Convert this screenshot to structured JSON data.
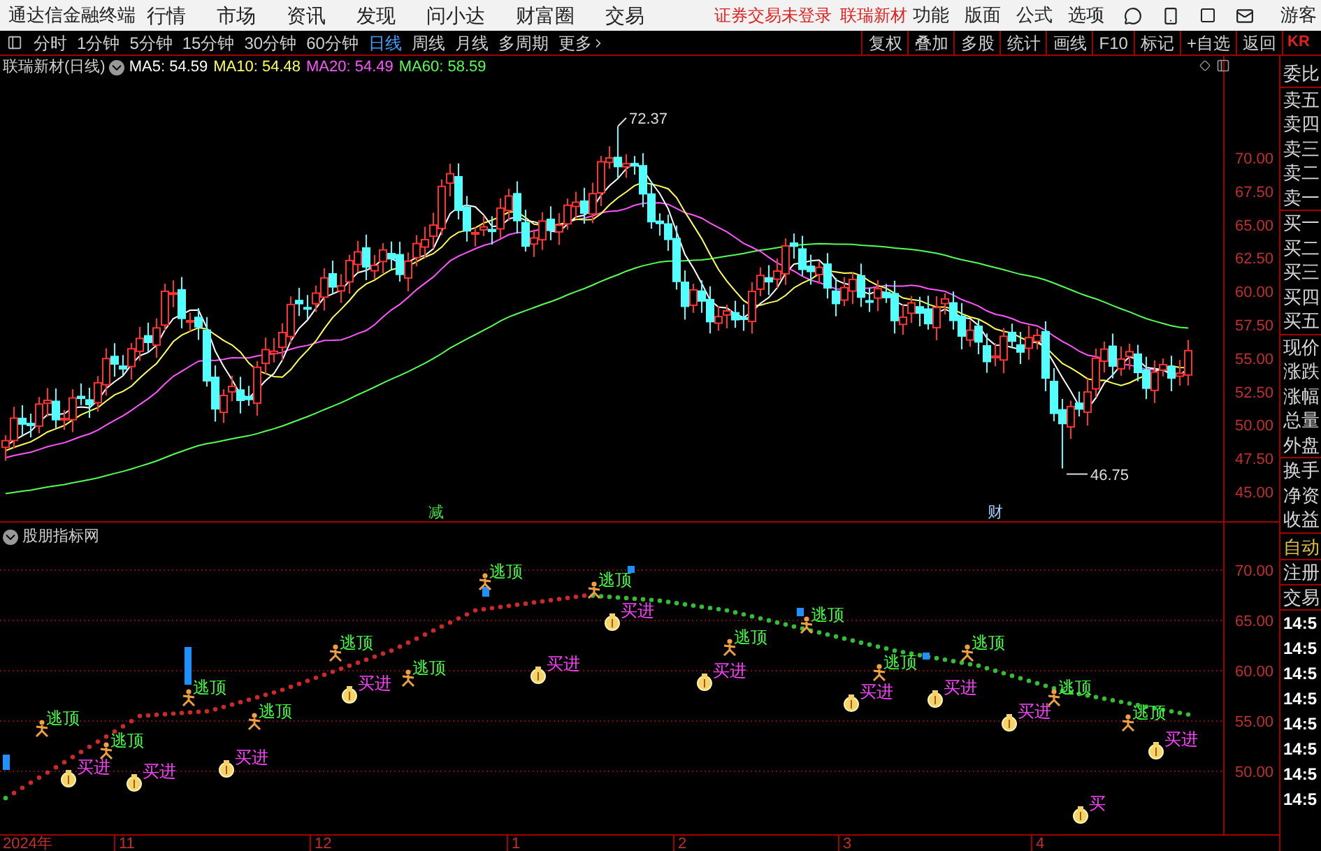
{
  "menu_bar": {
    "app_title": "通达信金融终端",
    "menus": [
      "行情",
      "市场",
      "资讯",
      "发现",
      "问小达",
      "财富圈",
      "交易"
    ],
    "notice": "证券交易未登录",
    "stock_link": "联瑞新材",
    "tools": [
      "功能",
      "版面",
      "公式",
      "选项"
    ],
    "user": "游客"
  },
  "period_bar": {
    "periods": [
      {
        "label": "分时",
        "selected": false
      },
      {
        "label": "1分钟",
        "selected": false
      },
      {
        "label": "5分钟",
        "selected": false
      },
      {
        "label": "15分钟",
        "selected": false
      },
      {
        "label": "30分钟",
        "selected": false
      },
      {
        "label": "60分钟",
        "selected": false
      },
      {
        "label": "日线",
        "selected": true
      },
      {
        "label": "周线",
        "selected": false
      },
      {
        "label": "月线",
        "selected": false
      },
      {
        "label": "多周期",
        "selected": false
      }
    ],
    "more": "更多",
    "actions": [
      "复权",
      "叠加",
      "多股",
      "统计",
      "画线",
      "F10",
      "标记",
      "+自选",
      "返回"
    ],
    "code": "KR"
  },
  "price_chart": {
    "title": "联瑞新材(日线)",
    "ma": [
      {
        "label": "MA5:",
        "value": "54.59",
        "color": "#ffffff"
      },
      {
        "label": "MA10:",
        "value": "54.48",
        "color": "#ffff54"
      },
      {
        "label": "MA20:",
        "value": "54.49",
        "color": "#ff54ff"
      },
      {
        "label": "MA60:",
        "value": "58.59",
        "color": "#54ff54"
      }
    ],
    "high_marker": "72.37",
    "low_marker": "46.75",
    "events": [
      "减",
      "财"
    ],
    "axis": [
      "70.00",
      "67.50",
      "65.00",
      "62.50",
      "60.00",
      "57.50",
      "55.00",
      "52.50",
      "50.00",
      "47.50",
      "45.00"
    ]
  },
  "indicator": {
    "title": "股朋指标网",
    "axis": [
      "70.00",
      "65.00",
      "60.00",
      "55.00",
      "50.00"
    ],
    "signals": [
      {
        "kind": "sell",
        "label": "逃顶"
      },
      {
        "kind": "buy",
        "label": "买进"
      },
      {
        "kind": "sell",
        "label": "逃顶"
      },
      {
        "kind": "buy",
        "label": "买进"
      },
      {
        "kind": "sell",
        "label": "逃顶"
      },
      {
        "kind": "buy",
        "label": "买进"
      },
      {
        "kind": "sell",
        "label": "逃顶"
      },
      {
        "kind": "sell",
        "label": "逃顶"
      },
      {
        "kind": "buy",
        "label": "买进"
      },
      {
        "kind": "sell",
        "label": "逃顶"
      },
      {
        "kind": "sell",
        "label": "逃顶"
      },
      {
        "kind": "buy",
        "label": "买进"
      },
      {
        "kind": "sell",
        "label": "逃顶"
      },
      {
        "kind": "buy",
        "label": "买进"
      },
      {
        "kind": "buy",
        "label": "买进"
      },
      {
        "kind": "sell",
        "label": "逃顶"
      },
      {
        "kind": "sell",
        "label": "逃顶"
      },
      {
        "kind": "buy",
        "label": "买进"
      },
      {
        "kind": "sell",
        "label": "逃顶"
      },
      {
        "kind": "buy",
        "label": "买进"
      },
      {
        "kind": "sell",
        "label": "逃顶"
      },
      {
        "kind": "buy",
        "label": "买进"
      },
      {
        "kind": "sell",
        "label": "逃顶"
      },
      {
        "kind": "buy",
        "label": "买"
      },
      {
        "kind": "sell",
        "label": "逃顶"
      },
      {
        "kind": "buy",
        "label": "买进"
      }
    ]
  },
  "date_axis": [
    "2024年",
    "11",
    "12",
    "1",
    "2",
    "3",
    "4"
  ],
  "quote_panel": {
    "groups": [
      [
        "委比"
      ],
      [
        "卖五",
        "卖四",
        "卖三",
        "卖二",
        "卖一"
      ],
      [
        "买一",
        "买二",
        "买三",
        "买四",
        "买五"
      ],
      [
        "现价",
        "涨跌",
        "涨幅",
        "总量",
        "外盘"
      ],
      [
        "换手",
        "净资",
        "收益"
      ]
    ],
    "auto": "自动",
    "buttons": [
      "注册",
      "交易"
    ],
    "times": [
      "14:5",
      "14:5",
      "14:5",
      "14:5",
      "14:5",
      "14:5",
      "14:5",
      "14:5"
    ]
  }
}
